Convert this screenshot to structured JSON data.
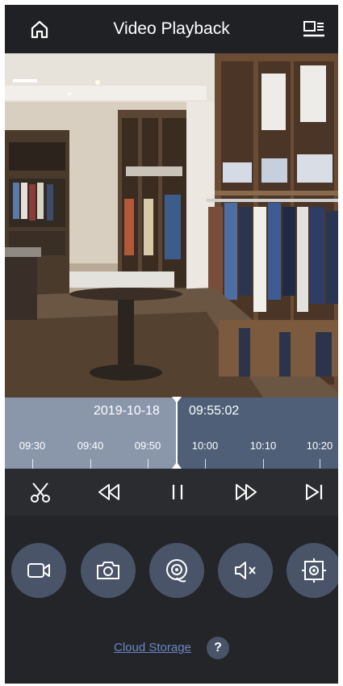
{
  "header": {
    "title": "Video Playback",
    "home_icon": "home-icon",
    "switch_icon": "camera-switch-icon"
  },
  "timeline": {
    "date": "2019-10-18",
    "time": "09:55:02",
    "ticks": [
      "09:30",
      "09:40",
      "09:50",
      "10:00",
      "10:10",
      "10:20"
    ]
  },
  "controls": {
    "items": [
      "clip-scissors-icon",
      "rewind-icon",
      "pause-icon",
      "fast-forward-icon",
      "next-icon"
    ]
  },
  "actions": {
    "items": [
      "record-video-icon",
      "snapshot-camera-icon",
      "playback-target-icon",
      "mute-icon",
      "capture-frame-icon"
    ]
  },
  "footer": {
    "cloud_storage": "Cloud Storage",
    "help": "?"
  },
  "colors": {
    "header_bg": "#1f2125",
    "timeline_bg": "#4f5f78",
    "timeline_played": "#8a97ab",
    "button_bg": "#4a5468",
    "link": "#6b86c9"
  }
}
